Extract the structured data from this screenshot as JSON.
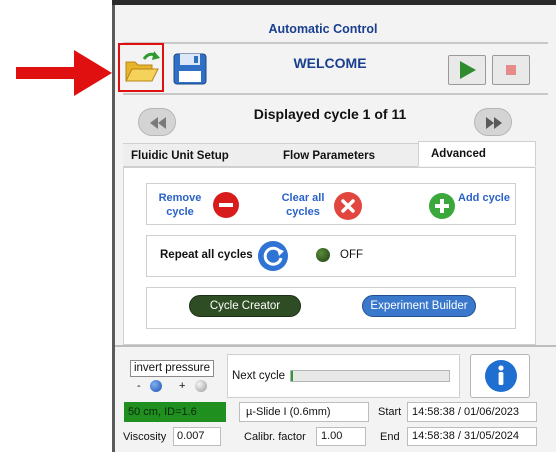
{
  "header": {
    "title": "Automatic Control",
    "welcome": "WELCOME"
  },
  "toolbar": {
    "open_icon": "folder-open-icon",
    "save_icon": "floppy-disk-icon",
    "play_icon": "play-icon",
    "stop_icon": "stop-icon"
  },
  "cycle_nav": {
    "label": "Displayed cycle 1 of 11",
    "prev_icon": "rewind-icon",
    "next_icon": "fast-forward-icon"
  },
  "tabs": [
    {
      "label": "Fluidic Unit Setup"
    },
    {
      "label": "Flow Parameters"
    },
    {
      "label": "Advanced"
    }
  ],
  "advanced": {
    "remove_label": "Remove cycle",
    "clear_label": "Clear all cycles",
    "add_label": "Add cycle",
    "repeat_label": "Repeat all cycles",
    "repeat_state": "OFF",
    "cycle_creator": "Cycle Creator",
    "experiment_builder": "Experiment Builder"
  },
  "bottom": {
    "invert_pressure": "invert pressure",
    "minus": "-",
    "plus": "+",
    "next_cycle_label": "Next cycle",
    "next_cycle_progress": 0.01,
    "status": "50 cm, ID=1.6",
    "slide": "µ-Slide I (0.6mm)",
    "start_label": "Start",
    "start_value": "14:58:38 / 01/06/2023",
    "end_label": "End",
    "end_value": "14:58:38 / 31/05/2024",
    "viscosity_label": "Viscosity",
    "viscosity_value": "0.007",
    "calib_label": "Calibr. factor",
    "calib_value": "1.00"
  },
  "colors": {
    "accent_red": "#e01010",
    "title_blue": "#1a3f8f",
    "status_green": "#1f8f1f"
  }
}
